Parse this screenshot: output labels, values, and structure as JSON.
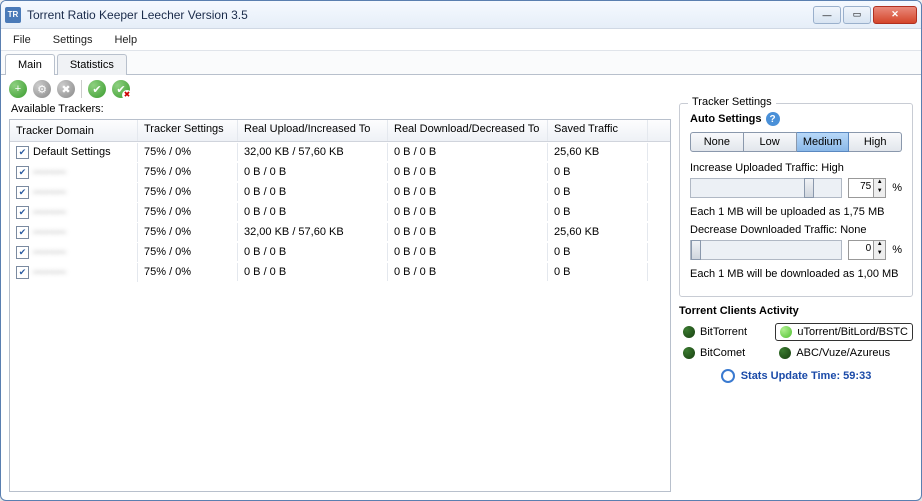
{
  "window": {
    "title": "Torrent Ratio Keeper Leecher Version  3.5"
  },
  "menu": {
    "file": "File",
    "settings": "Settings",
    "help": "Help"
  },
  "tabs": {
    "main": "Main",
    "statistics": "Statistics"
  },
  "section": {
    "available_trackers": "Available Trackers:"
  },
  "grid": {
    "headers": {
      "domain": "Tracker Domain",
      "settings": "Tracker Settings",
      "upload": "Real Upload/Increased To",
      "download": "Real Download/Decreased To",
      "saved": "Saved Traffic"
    },
    "rows": [
      {
        "checked": true,
        "domain": "Default Settings",
        "blurred": false,
        "settings": "75% / 0%",
        "upload": "32,00 KB / 57,60 KB",
        "download": "0 B / 0 B",
        "saved": "25,60 KB"
      },
      {
        "checked": true,
        "domain": "———",
        "blurred": true,
        "settings": "75% / 0%",
        "upload": "0 B / 0 B",
        "download": "0 B / 0 B",
        "saved": "0 B"
      },
      {
        "checked": true,
        "domain": "———",
        "blurred": true,
        "settings": "75% / 0%",
        "upload": "0 B / 0 B",
        "download": "0 B / 0 B",
        "saved": "0 B"
      },
      {
        "checked": true,
        "domain": "———",
        "blurred": true,
        "settings": "75% / 0%",
        "upload": "0 B / 0 B",
        "download": "0 B / 0 B",
        "saved": "0 B"
      },
      {
        "checked": true,
        "domain": "———",
        "blurred": true,
        "settings": "75% / 0%",
        "upload": "32,00 KB / 57,60 KB",
        "download": "0 B / 0 B",
        "saved": "25,60 KB"
      },
      {
        "checked": true,
        "domain": "———",
        "blurred": true,
        "settings": "75% / 0%",
        "upload": "0 B / 0 B",
        "download": "0 B / 0 B",
        "saved": "0 B"
      },
      {
        "checked": true,
        "domain": "———",
        "blurred": true,
        "settings": "75% / 0%",
        "upload": "0 B / 0 B",
        "download": "0 B / 0 B",
        "saved": "0 B"
      }
    ]
  },
  "tracker_settings": {
    "legend": "Tracker Settings",
    "auto_label": "Auto Settings",
    "levels": {
      "none": "None",
      "low": "Low",
      "medium": "Medium",
      "high": "High"
    },
    "active_level": "medium",
    "increase_label": "Increase Uploaded Traffic: High",
    "increase_value": "75",
    "increase_pct": "%",
    "increase_hint": "Each 1 MB will be uploaded as 1,75 MB",
    "decrease_label": "Decrease Downloaded Traffic: None",
    "decrease_value": "0",
    "decrease_pct": "%",
    "decrease_hint": "Each 1 MB will be downloaded as 1,00 MB"
  },
  "clients": {
    "title": "Torrent Clients Activity",
    "items": [
      {
        "name": "BitTorrent",
        "active": false,
        "boxed": false
      },
      {
        "name": "uTorrent/BitLord/BSTC",
        "active": true,
        "boxed": true
      },
      {
        "name": "BitComet",
        "active": false,
        "boxed": false
      },
      {
        "name": "ABC/Vuze/Azureus",
        "active": false,
        "boxed": false
      }
    ],
    "stats_label": "Stats Update Time: 59:33"
  }
}
